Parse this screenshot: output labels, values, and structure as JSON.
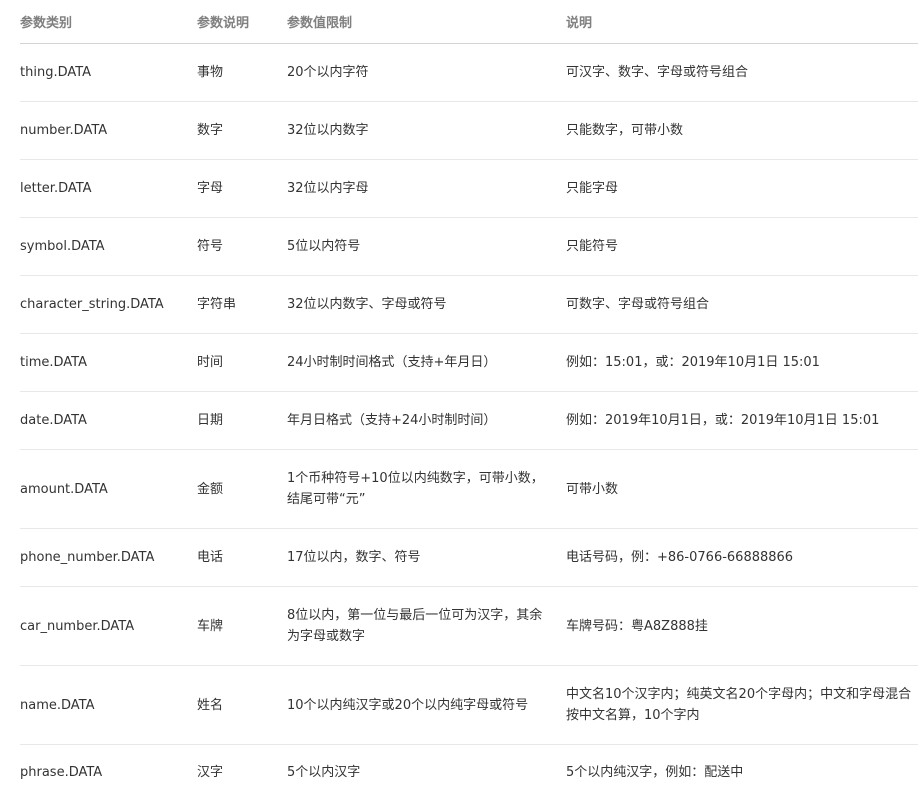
{
  "table": {
    "headers": [
      "参数类别",
      "参数说明",
      "参数值限制",
      "说明"
    ],
    "rows": [
      {
        "type": "thing.DATA",
        "name": "事物",
        "limit": "20个以内字符",
        "desc": "可汉字、数字、字母或符号组合"
      },
      {
        "type": "number.DATA",
        "name": "数字",
        "limit": "32位以内数字",
        "desc": "只能数字，可带小数"
      },
      {
        "type": "letter.DATA",
        "name": "字母",
        "limit": "32位以内字母",
        "desc": "只能字母"
      },
      {
        "type": "symbol.DATA",
        "name": "符号",
        "limit": "5位以内符号",
        "desc": "只能符号"
      },
      {
        "type": "character_string.DATA",
        "name": "字符串",
        "limit": "32位以内数字、字母或符号",
        "desc": "可数字、字母或符号组合"
      },
      {
        "type": "time.DATA",
        "name": "时间",
        "limit": "24小时制时间格式（支持+年月日）",
        "desc": "例如：15:01，或：2019年10月1日 15:01"
      },
      {
        "type": "date.DATA",
        "name": "日期",
        "limit": "年月日格式（支持+24小时制时间）",
        "desc": "例如：2019年10月1日，或：2019年10月1日 15:01"
      },
      {
        "type": "amount.DATA",
        "name": "金额",
        "limit": "1个币种符号+10位以内纯数字，可带小数，结尾可带“元”",
        "desc": "可带小数"
      },
      {
        "type": "phone_number.DATA",
        "name": "电话",
        "limit": "17位以内，数字、符号",
        "desc": "电话号码，例：+86-0766-66888866"
      },
      {
        "type": "car_number.DATA",
        "name": "车牌",
        "limit": "8位以内，第一位与最后一位可为汉字，其余为字母或数字",
        "desc": "车牌号码：粤A8Z888挂"
      },
      {
        "type": "name.DATA",
        "name": "姓名",
        "limit": "10个以内纯汉字或20个以内纯字母或符号",
        "desc": "中文名10个汉字内；纯英文名20个字母内；中文和字母混合按中文名算，10个字内"
      },
      {
        "type": "phrase.DATA",
        "name": "汉字",
        "limit": "5个以内汉字",
        "desc": "5个以内纯汉字，例如：配送中"
      }
    ]
  }
}
